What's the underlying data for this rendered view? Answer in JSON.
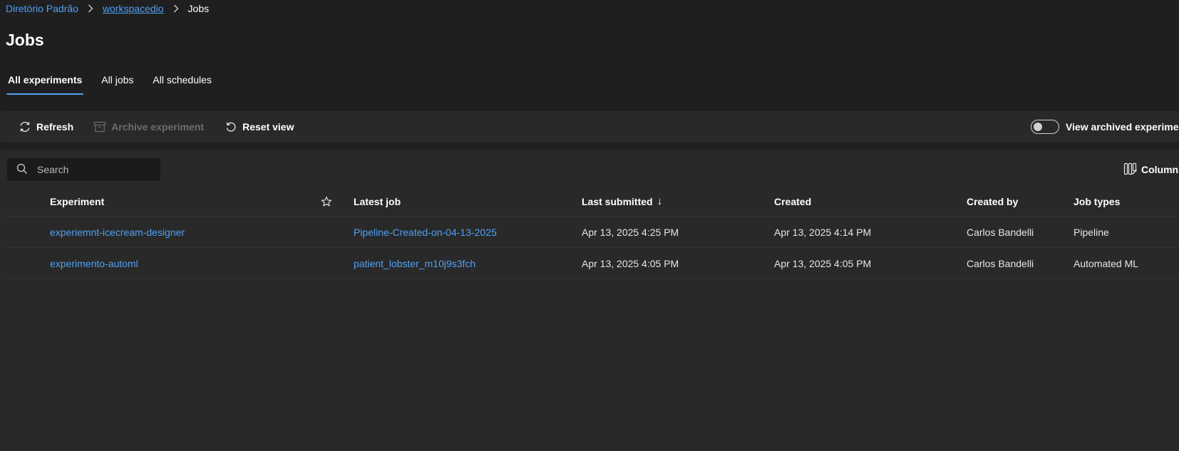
{
  "breadcrumb": {
    "items": [
      {
        "label": "Diretório Padrão"
      },
      {
        "label": "workspacedio"
      },
      {
        "label": "Jobs"
      }
    ]
  },
  "page": {
    "title": "Jobs"
  },
  "tabs": [
    {
      "label": "All experiments",
      "active": true
    },
    {
      "label": "All jobs",
      "active": false
    },
    {
      "label": "All schedules",
      "active": false
    }
  ],
  "toolbar": {
    "refresh_label": "Refresh",
    "archive_label": "Archive experiment",
    "reset_label": "Reset view",
    "toggle_label": "View archived experiments",
    "toggle_on": false
  },
  "search": {
    "placeholder": "Search"
  },
  "columns_label": "Columns",
  "table": {
    "headers": {
      "experiment": "Experiment",
      "latest_job": "Latest job",
      "last_submitted": "Last submitted",
      "sort_indicator": "↓",
      "created": "Created",
      "created_by": "Created by",
      "job_types": "Job types"
    },
    "rows": [
      {
        "experiment": "experiemnt-icecream-designer",
        "latest_job": "Pipeline-Created-on-04-13-2025",
        "last_submitted": "Apr 13, 2025 4:25 PM",
        "created": "Apr 13, 2025 4:14 PM",
        "created_by": "Carlos Bandelli",
        "job_types": "Pipeline"
      },
      {
        "experiment": "experimento-automl",
        "latest_job": "patient_lobster_m10j9s3fch",
        "last_submitted": "Apr 13, 2025 4:05 PM",
        "created": "Apr 13, 2025 4:05 PM",
        "created_by": "Carlos Bandelli",
        "job_types": "Automated ML"
      }
    ]
  },
  "colors": {
    "background": "#1f1f1f",
    "panel": "#292929",
    "accent": "#4ea1f3",
    "disabled": "#6d6d6d"
  },
  "icons": [
    "chevron-right-icon",
    "refresh-icon",
    "archive-icon",
    "reset-icon",
    "search-icon",
    "columns-icon",
    "star-icon",
    "sort-down-icon"
  ]
}
